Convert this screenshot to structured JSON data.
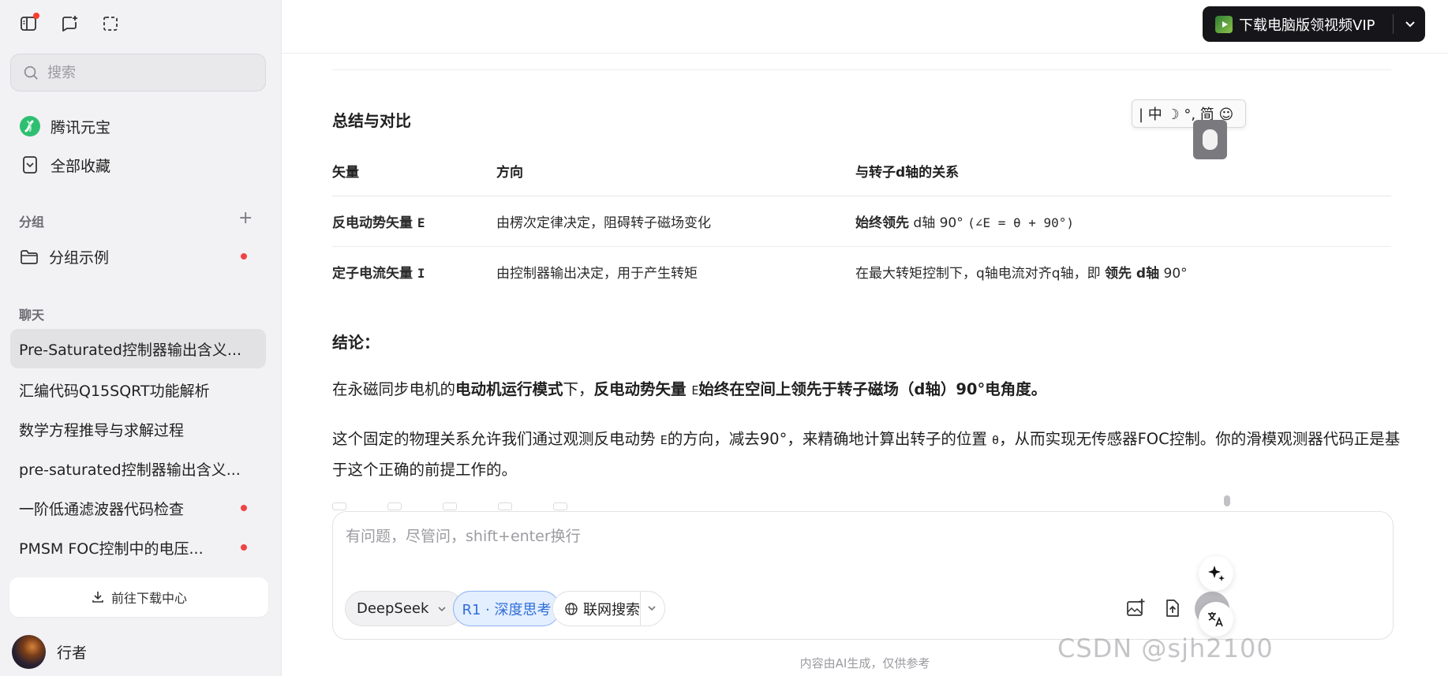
{
  "sidebar": {
    "search_placeholder": "搜索",
    "nav": [
      {
        "label": "腾讯元宝",
        "icon": "yuanbao-logo-icon"
      },
      {
        "label": "全部收藏",
        "icon": "bookmark-icon"
      }
    ],
    "group_section_title": "分组",
    "group_item": "分组示例",
    "chat_section_title": "聊天",
    "chats": [
      "Pre-Saturated控制器输出含义...",
      "汇编代码Q15SQRT功能解析",
      "数学方程推导与求解过程",
      "pre-saturated控制器输出含义...",
      "一阶低通滤波器代码检查",
      "PMSM FOC控制中的电压..."
    ],
    "download_center": "前往下载中心",
    "user_name": "行者"
  },
  "header": {
    "vip_button": "下载电脑版领视频VIP"
  },
  "content": {
    "section_title": "总结与对比",
    "table": {
      "headers": [
        "矢量",
        "方向",
        "与转子d轴的关系"
      ],
      "rows": [
        {
          "vector_bold": "反电动势矢量",
          "vector_sym": "E",
          "direction": "由楞次定律决定，阻碍转子磁场变化",
          "rel_bold": "始终领先",
          "rel_mid": " d轴",
          "rel_deg": " 90°",
          "rel_code": "(∠E = θ + 90°)"
        },
        {
          "vector_bold": "定子电流矢量",
          "vector_sym": "I",
          "direction": "由控制器输出决定，用于产生转矩",
          "rel_text": "在最大转矩控制下，q轴电流对齐q轴，即",
          "rel_bold": "领先 d轴",
          "rel_deg": " 90°"
        }
      ]
    },
    "conclusion_title": "结论：",
    "para1": {
      "a": "在永磁同步电机的",
      "b": "电动机运行模式",
      "c": "下，",
      "d": "反电动势矢量 ",
      "e": "E",
      "f": "始终在空间上领先于转子磁场（d轴）90°电角度",
      "g": "。"
    },
    "para2": {
      "a": "这个固定的物理关系允许我们通过观测反电动势",
      "b": "E",
      "c": "的方向，减去90°，来精确地计算出转子的位置",
      "d": "θ",
      "e": "，从而实现无传感器FOC控制。你的滑模观测器代码正是基于这个正确的前提工作的。"
    }
  },
  "composer": {
    "placeholder": "有问题，尽管问，shift+enter换行",
    "model": "DeepSeek",
    "deep_think": "R1 · 深度思考",
    "web_search": "联网搜索"
  },
  "disclaimer": "内容由AI生成，仅供参考",
  "ime": {
    "text": "| 中 ☽ °, 简 ☺"
  },
  "watermark": "CSDN @sjh2100"
}
